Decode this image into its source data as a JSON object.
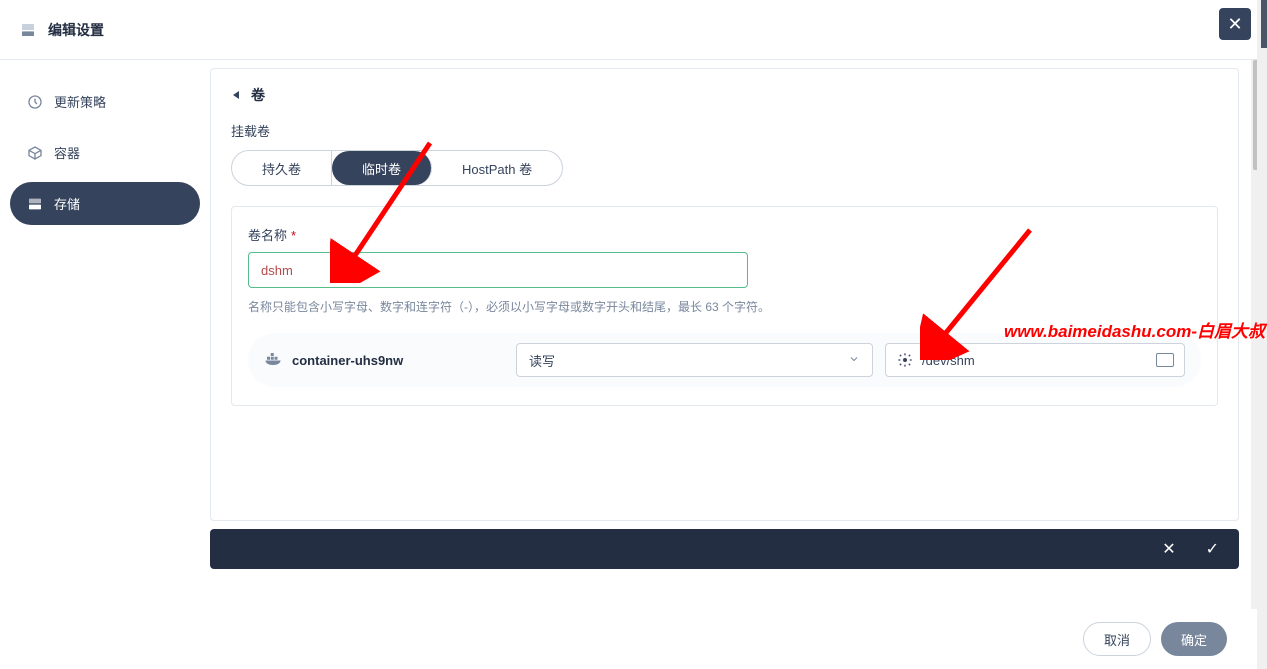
{
  "header": {
    "title": "编辑设置"
  },
  "sidebar": {
    "items": [
      {
        "label": "更新策略",
        "icon": "strategy-icon"
      },
      {
        "label": "容器",
        "icon": "container-icon"
      },
      {
        "label": "存储",
        "icon": "storage-icon"
      }
    ],
    "activeIndex": 2
  },
  "card": {
    "title": "卷",
    "mountSectionLabel": "挂载卷",
    "tabs": [
      {
        "label": "持久卷"
      },
      {
        "label": "临时卷"
      },
      {
        "label": "HostPath 卷"
      }
    ],
    "activeTabIndex": 1,
    "volumeNameLabel": "卷名称",
    "volumeNameValue": "dshm",
    "volumeNameHint": "名称只能包含小写字母、数字和连字符（-），必须以小写字母或数字开头和结尾，最长 63 个字符。",
    "containerName": "container-uhs9nw",
    "modeSelect": "读写",
    "mountPath": "/dev/shm"
  },
  "footer": {
    "cancel": "取消",
    "confirm": "确定"
  },
  "watermark": "www.baimeidashu.com-白眉大叔"
}
